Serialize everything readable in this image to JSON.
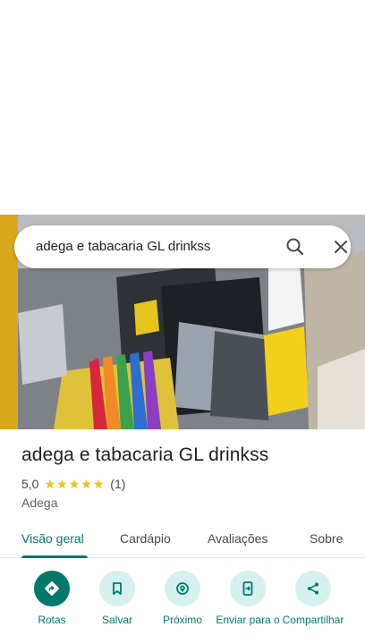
{
  "search": {
    "query": "adega e tabacaria GL drinkss"
  },
  "place": {
    "name": "adega e tabacaria GL drinkss",
    "rating": "5,0",
    "stars": 5,
    "review_count": "(1)",
    "category": "Adega"
  },
  "tabs": [
    {
      "label": "Visão geral",
      "active": true
    },
    {
      "label": "Cardápio",
      "active": false
    },
    {
      "label": "Avaliações",
      "active": false
    },
    {
      "label": "Sobre",
      "active": false
    }
  ],
  "actions": [
    {
      "label": "Rotas",
      "icon": "directions-icon"
    },
    {
      "label": "Salvar",
      "icon": "bookmark-icon"
    },
    {
      "label": "Próximo",
      "icon": "nearby-icon"
    },
    {
      "label": "Enviar para o",
      "icon": "send-to-phone-icon"
    },
    {
      "label": "Compartilhar",
      "icon": "share-icon"
    }
  ],
  "colors": {
    "accent": "#00796b",
    "action_bg": "#d5f0ef",
    "star": "#fbbc04"
  }
}
